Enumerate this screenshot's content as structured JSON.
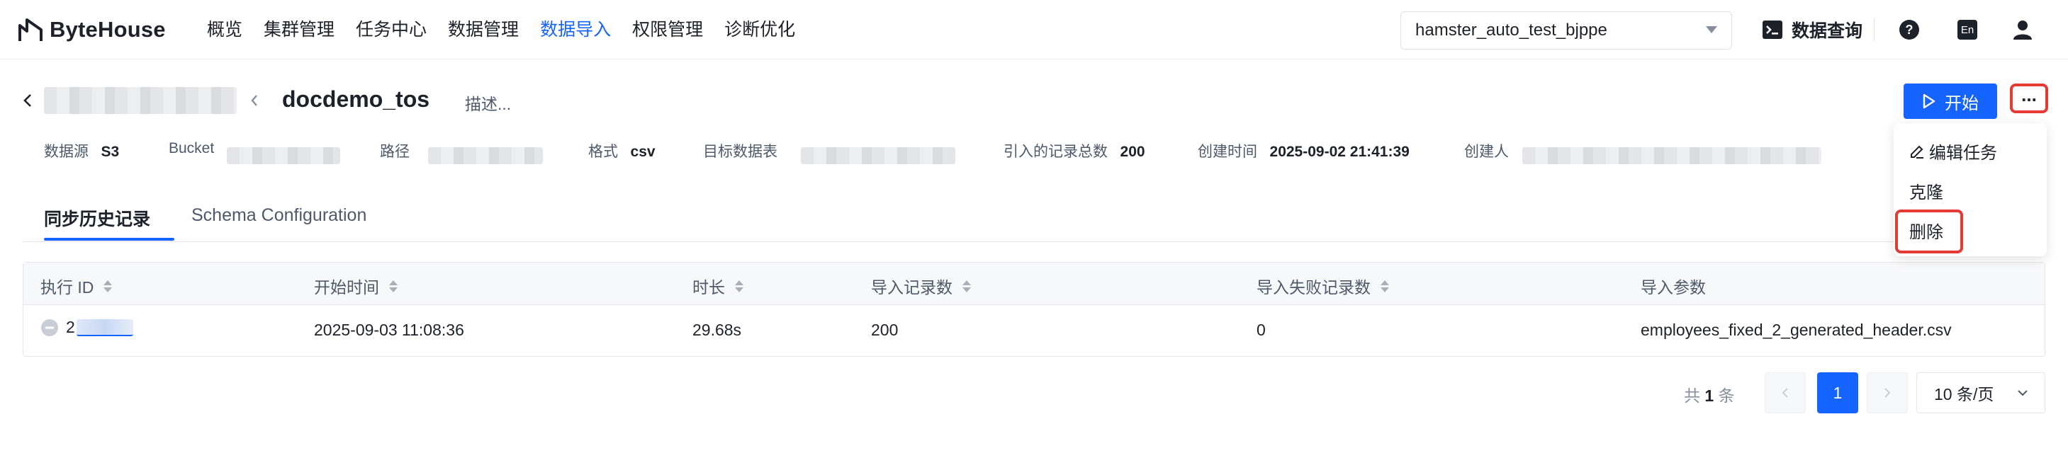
{
  "brand": {
    "name": "ByteHouse"
  },
  "nav": [
    "概览",
    "集群管理",
    "任务中心",
    "数据管理",
    "数据导入",
    "权限管理",
    "诊断优化"
  ],
  "nav_active_index": 4,
  "database_select": {
    "value": "hamster_auto_test_bjppe"
  },
  "header_right": {
    "query_label": "数据查询",
    "lang_label": "En"
  },
  "task": {
    "title": "docdemo_tos",
    "desc_placeholder": "描述...",
    "start_label": "开始",
    "more_label": "..."
  },
  "meta": {
    "source_label": "数据源",
    "source_value": "S3",
    "bucket_label": "Bucket",
    "path_label": "路径",
    "format_label": "格式",
    "format_value": "csv",
    "target_label": "目标数据表",
    "records_label": "引入的记录总数",
    "records_value": "200",
    "created_label": "创建时间",
    "created_value": "2025-09-02 21:41:39",
    "creator_label": "创建人"
  },
  "tabs": [
    "同步历史记录",
    "Schema Configuration"
  ],
  "table": {
    "columns": [
      "执行 ID",
      "开始时间",
      "时长",
      "导入记录数",
      "导入失败记录数",
      "导入参数"
    ],
    "rows": [
      {
        "id": "2",
        "start": "2025-09-03 11:08:36",
        "duration": "29.68s",
        "imported": "200",
        "failed": "0",
        "params": "employees_fixed_2_generated_header.csv"
      }
    ]
  },
  "pagination": {
    "total_prefix": "共",
    "total": "1",
    "total_suffix": "条",
    "current": "1",
    "page_size": "10 条/页"
  },
  "dropdown": {
    "edit": "编辑任务",
    "clone": "克隆",
    "delete": "删除"
  },
  "colors": {
    "primary": "#1664ff",
    "highlight": "#e53935"
  }
}
